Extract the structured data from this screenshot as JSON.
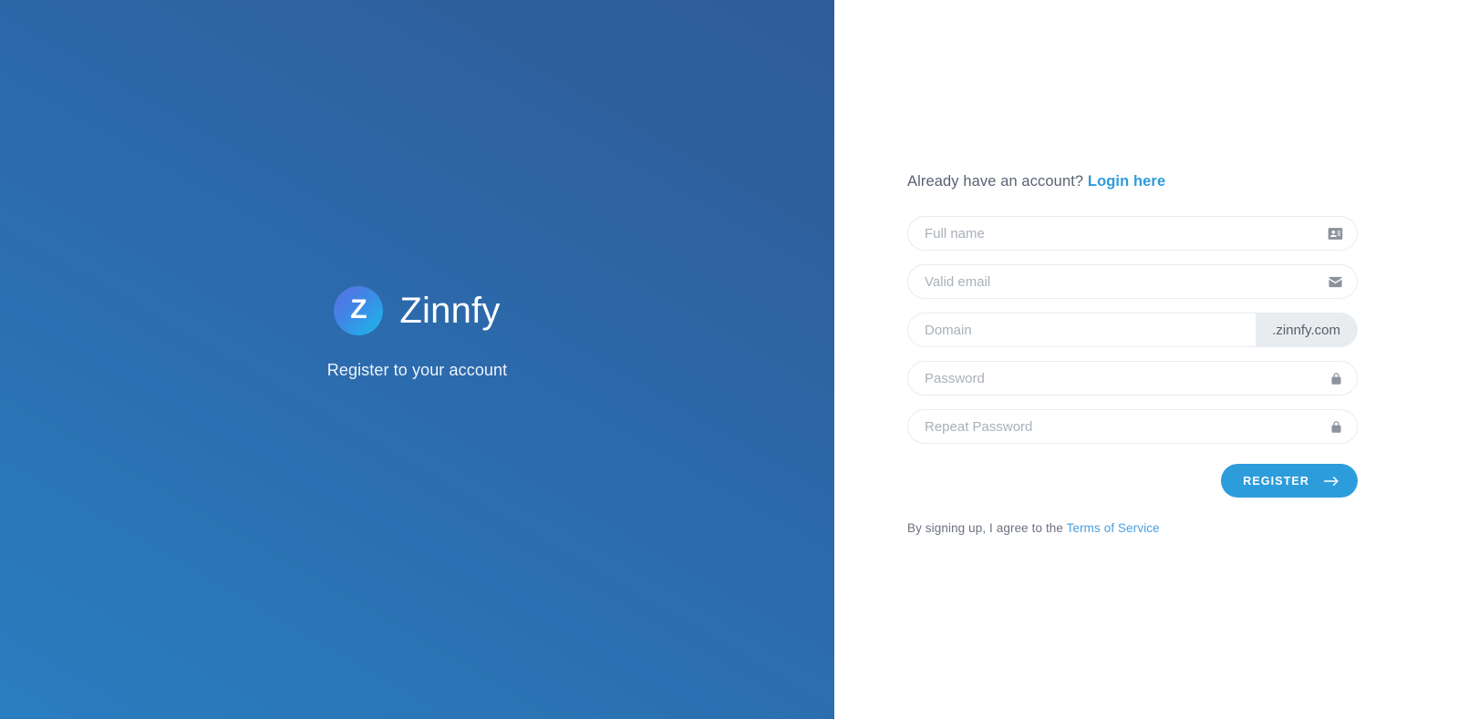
{
  "brand": {
    "logo_letter": "Z",
    "logo_icon": "zinnfy-logo-circle",
    "name": "Zinnfy",
    "subtitle": "Register to your account",
    "gradient_from": "#2a7ec0",
    "gradient_to": "#2f5c99",
    "logo_gradient_from": "#5b6fe0",
    "logo_gradient_to": "#22b3e3"
  },
  "form": {
    "account_prompt": "Already have an account?",
    "login_link": "Login here",
    "fields": [
      {
        "name": "full-name",
        "placeholder": "Full name",
        "value": "",
        "icon": "id-card-icon",
        "type": "text"
      },
      {
        "name": "email",
        "placeholder": "Valid email",
        "value": "",
        "icon": "envelope-icon",
        "type": "email"
      },
      {
        "name": "domain",
        "placeholder": "Domain",
        "value": "",
        "icon": "",
        "type": "text",
        "addon": ".zinnfy.com"
      },
      {
        "name": "password",
        "placeholder": "Password",
        "value": "",
        "icon": "lock-icon",
        "type": "password"
      },
      {
        "name": "repeat-password",
        "placeholder": "Repeat Password",
        "value": "",
        "icon": "lock-icon",
        "type": "password"
      }
    ],
    "submit_label": "REGISTER",
    "submit_icon": "arrow-right-icon",
    "terms_prefix": "By signing up, I agree to the ",
    "terms_link": "Terms of Service",
    "accent_color": "#2d9cdb",
    "link_color": "#4a9fe0",
    "addon_bg": "#e9ecef"
  }
}
